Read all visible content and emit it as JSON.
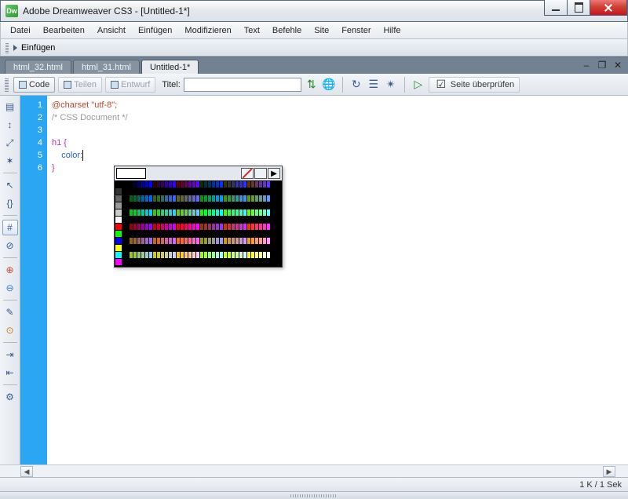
{
  "title": "Adobe Dreamweaver CS3 - [Untitled-1*]",
  "app_icon_text": "Dw",
  "menubar": [
    "Datei",
    "Bearbeiten",
    "Ansicht",
    "Einfügen",
    "Modifizieren",
    "Text",
    "Befehle",
    "Site",
    "Fenster",
    "Hilfe"
  ],
  "insertbar_label": "Einfügen",
  "tabs": [
    "html_32.html",
    "html_31.html",
    "Untitled-1*"
  ],
  "active_tab": 2,
  "doc_toolbar": {
    "code": "Code",
    "split": "Teilen",
    "design": "Entwurf",
    "title_label": "Titel:",
    "title_value": "",
    "check_page": "Seite überprüfen"
  },
  "code": {
    "lines": [
      "1",
      "2",
      "3",
      "4",
      "5",
      "6"
    ],
    "l1": "@charset \"utf-8\";",
    "l2": "/* CSS Document */",
    "l3": "",
    "l4": "h1 {",
    "l5_indent": "    ",
    "l5_prop": "color:",
    "l6": "}"
  },
  "status": "1 K / 1 Sek"
}
